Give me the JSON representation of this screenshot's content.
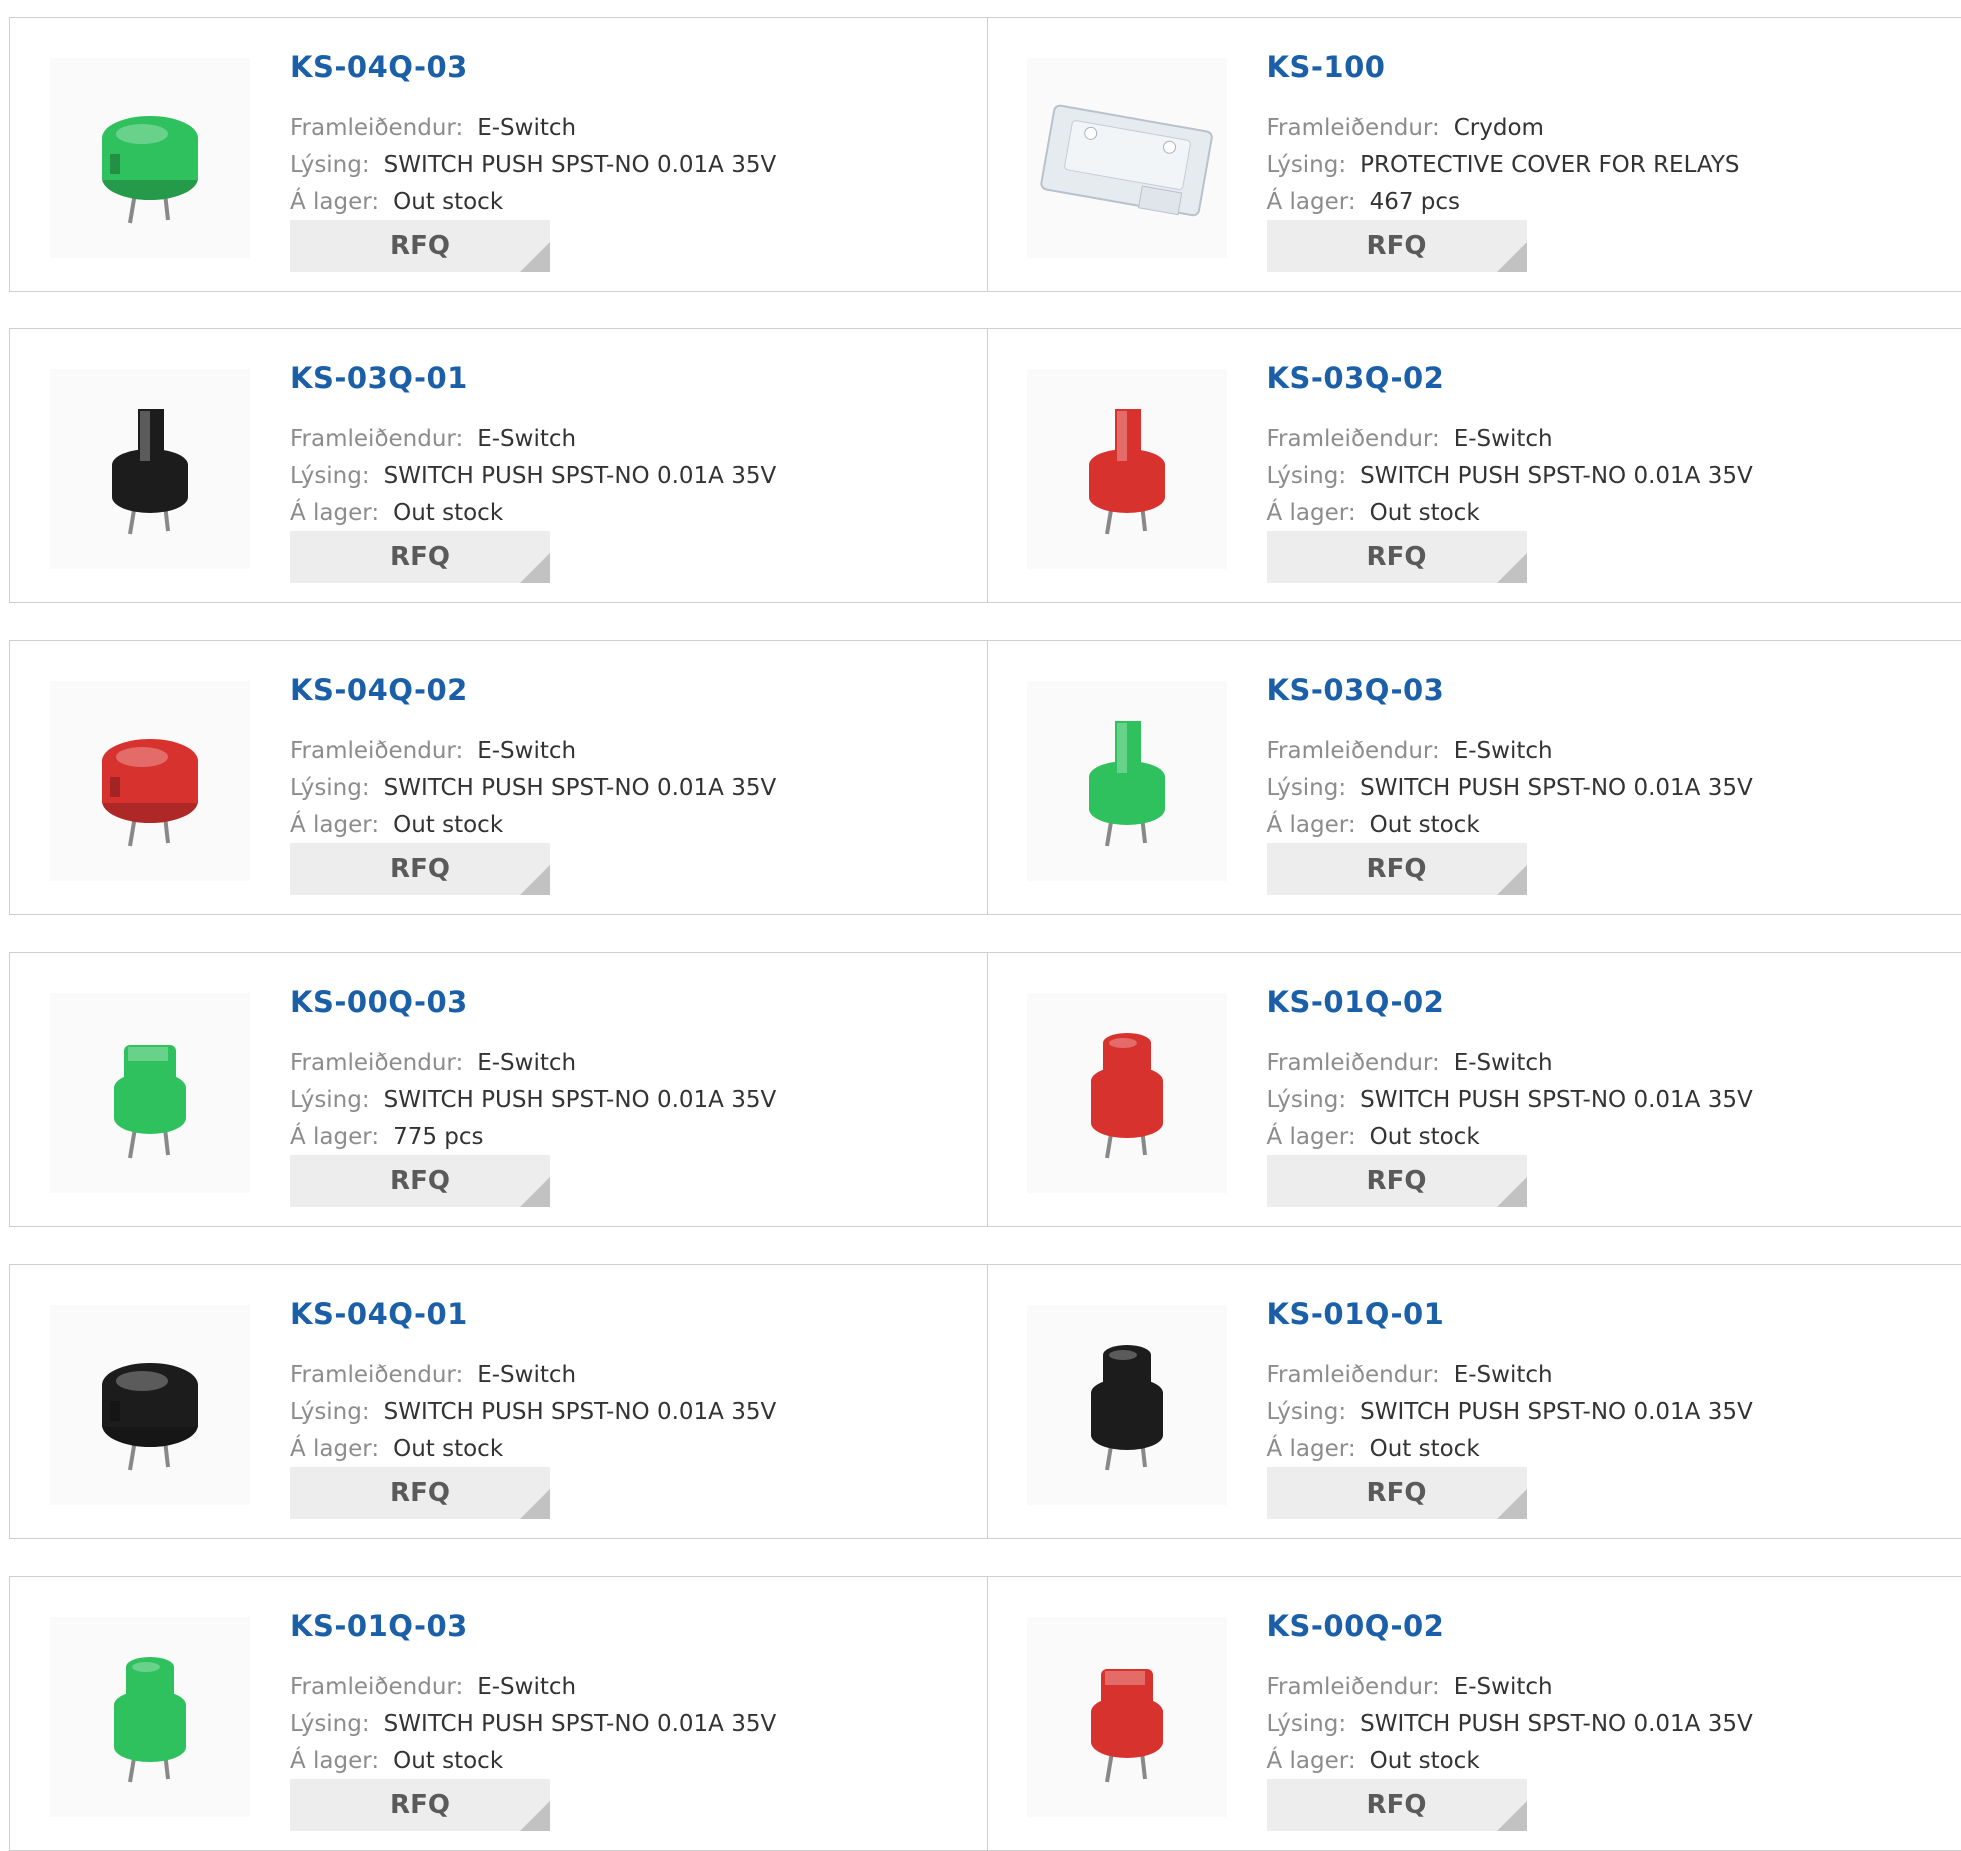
{
  "labels": {
    "manufacturer": "Framleiðendur:",
    "description": "Lýsing:",
    "stock": "Á lager:",
    "rfq": "RFQ"
  },
  "colors": {
    "title": "#1a5fa8",
    "green": "#2fc15e",
    "red": "#d8322f",
    "black": "#1c1c1c",
    "clear": "#d7dde3"
  },
  "products": [
    {
      "part": "KS-04Q-03",
      "manufacturer": "E-Switch",
      "description": "SWITCH PUSH SPST-NO 0.01A 35V",
      "stock": "Out stock",
      "image": "green-round-switch"
    },
    {
      "part": "KS-100",
      "manufacturer": "Crydom",
      "description": "PROTECTIVE COVER FOR RELAYS",
      "stock": "467 pcs",
      "image": "clear-relay-cover"
    },
    {
      "part": "KS-03Q-01",
      "manufacturer": "E-Switch",
      "description": "SWITCH PUSH SPST-NO 0.01A 35V",
      "stock": "Out stock",
      "image": "black-tall-switch"
    },
    {
      "part": "KS-03Q-02",
      "manufacturer": "E-Switch",
      "description": "SWITCH PUSH SPST-NO 0.01A 35V",
      "stock": "Out stock",
      "image": "red-tall-switch"
    },
    {
      "part": "KS-04Q-02",
      "manufacturer": "E-Switch",
      "description": "SWITCH PUSH SPST-NO 0.01A 35V",
      "stock": "Out stock",
      "image": "red-round-switch"
    },
    {
      "part": "KS-03Q-03",
      "manufacturer": "E-Switch",
      "description": "SWITCH PUSH SPST-NO 0.01A 35V",
      "stock": "Out stock",
      "image": "green-tall-switch"
    },
    {
      "part": "KS-00Q-03",
      "manufacturer": "E-Switch",
      "description": "SWITCH PUSH SPST-NO 0.01A 35V",
      "stock": "775 pcs",
      "image": "green-square-switch"
    },
    {
      "part": "KS-01Q-02",
      "manufacturer": "E-Switch",
      "description": "SWITCH PUSH SPST-NO 0.01A 35V",
      "stock": "Out stock",
      "image": "red-cylinder-switch"
    },
    {
      "part": "KS-04Q-01",
      "manufacturer": "E-Switch",
      "description": "SWITCH PUSH SPST-NO 0.01A 35V",
      "stock": "Out stock",
      "image": "black-round-switch"
    },
    {
      "part": "KS-01Q-01",
      "manufacturer": "E-Switch",
      "description": "SWITCH PUSH SPST-NO 0.01A 35V",
      "stock": "Out stock",
      "image": "black-cylinder-switch"
    },
    {
      "part": "KS-01Q-03",
      "manufacturer": "E-Switch",
      "description": "SWITCH PUSH SPST-NO 0.01A 35V",
      "stock": "Out stock",
      "image": "green-cylinder-switch"
    },
    {
      "part": "KS-00Q-02",
      "manufacturer": "E-Switch",
      "description": "SWITCH PUSH SPST-NO 0.01A 35V",
      "stock": "Out stock",
      "image": "red-square-switch"
    }
  ]
}
